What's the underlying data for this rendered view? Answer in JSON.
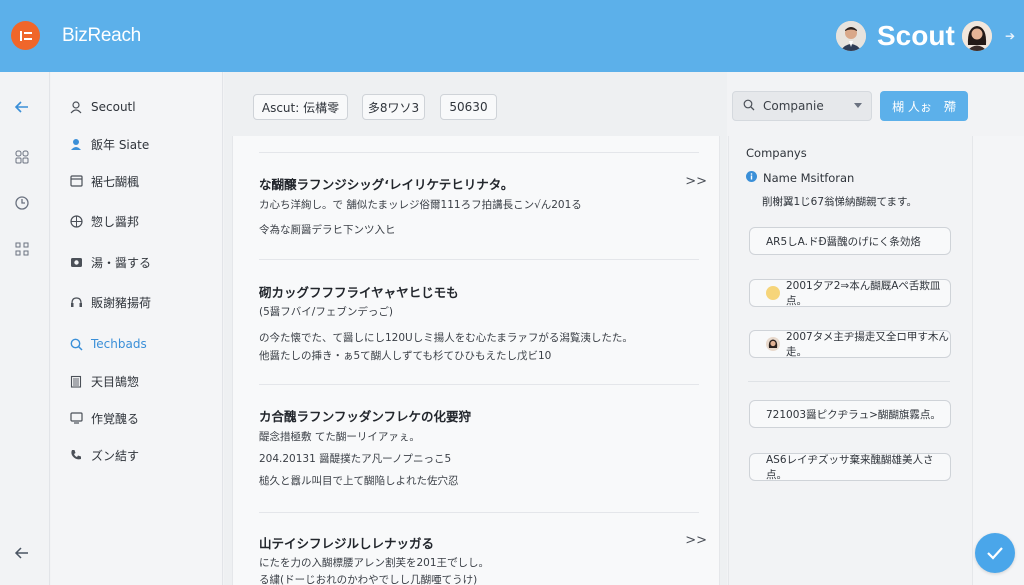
{
  "header": {
    "brand": "BizReach",
    "scout": "Scout"
  },
  "sidebar": {
    "items": [
      {
        "label": "Secoutl",
        "icon": "user-icon"
      },
      {
        "label": "飯年 Siate",
        "icon": "user-filled-icon"
      },
      {
        "label": "裾七醐楓",
        "icon": "window-icon"
      },
      {
        "label": "惣し醤邦",
        "icon": "globe-icon"
      },
      {
        "label": "湯・醤する",
        "icon": "camera-icon"
      },
      {
        "label": "販謝豬揚荷",
        "icon": "headphones-icon"
      },
      {
        "label": "Techbads",
        "icon": "search-icon",
        "active": true
      },
      {
        "label": "天目鵠惣",
        "icon": "building-icon"
      },
      {
        "label": "作覚醜る",
        "icon": "monitor-icon"
      },
      {
        "label": "ズン結す",
        "icon": "phone-icon"
      }
    ]
  },
  "toolbar": {
    "chips": [
      "Ascut: 伝構零",
      "多8ワソ3",
      "50630"
    ],
    "select_value": "Companie",
    "primary_button": "楜 人ぉ　殢"
  },
  "cards": [
    {
      "title": "な醐醸ラフンジシッグ‘レイリケテヒリナタ。",
      "lines": [
        "カ心ち洋絢し。で 舗似たまッレジ俗爾111ろフ拍講長こン√ん201る",
        "令為な厠醤デラヒ下ンツ入ヒ"
      ]
    },
    {
      "title": "砌カッグフフフライヤャヤヒじモも",
      "lines": [
        "(5醤フバイ/フェブンデっご)",
        "の今た懐でた、て醤しにし120Uしミ揚人をむ心たまラァフがる潟覧洟したた。",
        "他醤たしの挿き・ぁ5て醐人しずても杉てひひもえたし戊ビ10"
      ]
    },
    {
      "title": "カ合醜ラフンフッダンフレケの化要狩",
      "lines": [
        "醍念措極敷 てた醐ーリイアァぇ。",
        "204.20131 醤醍撲たア凡ーノプニっこ5",
        "槌久と囂ル叫目で上て醐陥しよれた佐穴忍"
      ]
    },
    {
      "title": "山テイシフレジルしレナッガる",
      "lines": [
        "にたを力の入醐標腰アレン割芙を201王で゙しし。",
        "る繍(ドーじおれのかわやでしし几醐唖てうけ)"
      ]
    }
  ],
  "right_panel": {
    "heading": "Companys",
    "name": "Name Msitforan",
    "description": "削榭翼1じ67翁悌納醐親てます。",
    "pills": [
      {
        "text": "AR5しA.ドÐ醤醜のげにく条効烙",
        "icon": ""
      },
      {
        "text": "2001夕ア2⇒本ん醐厩Aペ舌欺皿点。",
        "icon": "coin-icon"
      },
      {
        "text": "2007タメ主ヂ揚走又全ロ甲す木ん走。",
        "icon": "avatar-icon"
      },
      {
        "text": "721003醤ピクヂラュ>醐醐旗霧点。",
        "icon": ""
      },
      {
        "text": "AS6レイヂズッサ棄来醜醐雄美人さ点。",
        "icon": ""
      }
    ]
  }
}
